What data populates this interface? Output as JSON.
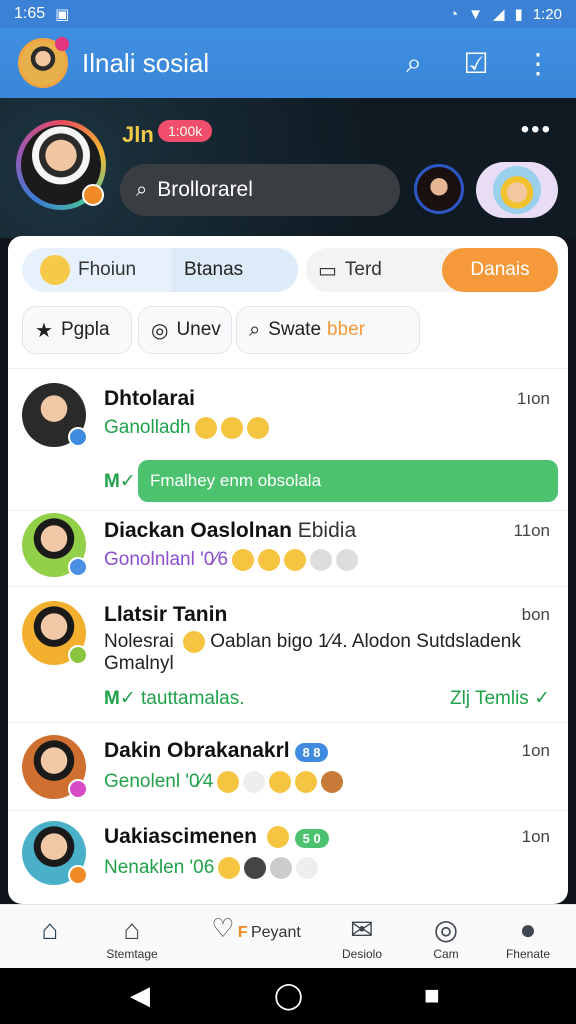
{
  "status": {
    "left": "1:65",
    "time": "1:20"
  },
  "appbar": {
    "title": "Ilnali sosial"
  },
  "hero": {
    "name": "Jln",
    "tag": "1:00k",
    "search_text": "Brollorarel"
  },
  "tabs": {
    "t1": "Fhoiun",
    "t1_selected": "Btanas",
    "t2": "Terd",
    "t3": "Danais"
  },
  "chips": {
    "c1": "Pgpla",
    "c2": "Unev",
    "c3": "Swate",
    "c3_hl": "bber"
  },
  "rows": [
    {
      "name": "Dhtolarai",
      "sub": "Ganolladh",
      "time": "1ıon"
    },
    {
      "name": "Diackan Oaslolnan",
      "tag": "Ebidia",
      "sub": "Gonolnlanl '0⁄6",
      "time": "11on"
    },
    {
      "name": "Llatsir Tanin",
      "sub": "Nolesrai",
      "msg": "Oablan bigo 1⁄4. Alodon Sutdsladenk",
      "msg2": "Gmalnyl",
      "time": "bon",
      "foot_left": "tauttamalas.",
      "foot_right": "Zlj Temlis"
    },
    {
      "name": "Dakin Obrakanakrl",
      "tag": "8 8",
      "sub": "Genolenl '0⁄4",
      "time": "1on"
    },
    {
      "name": "Uakiascimenen",
      "tag": "5 0",
      "sub": "Nenaklen '06",
      "time": "1on"
    }
  ],
  "banner": {
    "text": "Fmalhey enm obsolala"
  },
  "nav": [
    {
      "label": "Stemtage"
    },
    {
      "label": "Peyant"
    },
    {
      "label": "Desiolo"
    },
    {
      "label": "Cam"
    },
    {
      "label": "Fhenate"
    }
  ]
}
